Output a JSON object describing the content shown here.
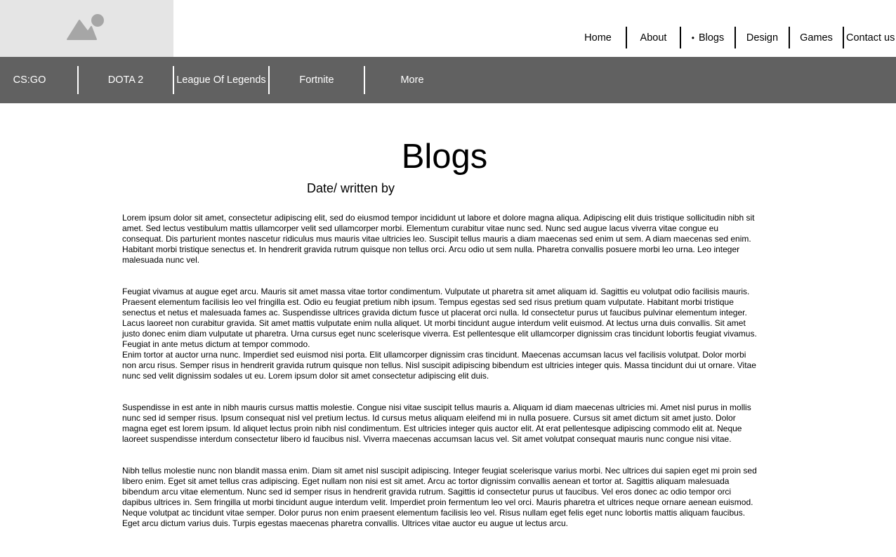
{
  "logo": {
    "icon": "image-placeholder-icon"
  },
  "nav": {
    "items": [
      {
        "label": "Home",
        "active": false
      },
      {
        "label": "About",
        "active": false
      },
      {
        "label": "Blogs",
        "active": true,
        "bullet": "•"
      },
      {
        "label": "Design",
        "active": false
      },
      {
        "label": "Games",
        "active": false
      },
      {
        "label": "Contact us",
        "active": false
      }
    ]
  },
  "games": {
    "items": [
      {
        "label": "CS:GO"
      },
      {
        "label": "DOTA 2"
      },
      {
        "label": "League Of Legends"
      },
      {
        "label": "Fortnite"
      },
      {
        "label": "More"
      }
    ]
  },
  "page": {
    "title": "Blogs",
    "byline": "Date/ written by"
  },
  "paragraphs": [
    "Lorem ipsum dolor sit amet, consectetur adipiscing elit, sed do eiusmod tempor incididunt ut labore et dolore magna aliqua. Adipiscing elit duis tristique sollicitudin nibh sit amet. Sed lectus vestibulum mattis ullamcorper velit sed ullamcorper morbi. Elementum curabitur vitae nunc sed. Nunc sed augue lacus viverra vitae congue eu consequat. Dis parturient montes nascetur ridiculus mus mauris vitae ultricies leo. Suscipit tellus mauris a diam maecenas sed enim ut sem. A diam maecenas sed enim. Habitant morbi tristique senectus et. In hendrerit gravida rutrum quisque non tellus orci. Arcu odio ut sem nulla. Pharetra convallis posuere morbi leo urna. Leo integer malesuada nunc vel.",
    "Feugiat vivamus at augue eget arcu. Mauris sit amet massa vitae tortor condimentum. Vulputate ut pharetra sit amet aliquam id. Sagittis eu volutpat odio facilisis mauris. Praesent elementum facilisis leo vel fringilla est. Odio eu feugiat pretium nibh ipsum. Tempus egestas sed sed risus pretium quam vulputate. Habitant morbi tristique senectus et netus et malesuada fames ac. Suspendisse ultrices gravida dictum fusce ut placerat orci nulla. Id consectetur purus ut faucibus pulvinar elementum integer. Lacus laoreet non curabitur gravida. Sit amet mattis vulputate enim nulla aliquet. Ut morbi tincidunt augue interdum velit euismod. At lectus urna duis convallis. Sit amet justo donec enim diam vulputate ut pharetra. Urna cursus eget nunc scelerisque viverra. Est pellentesque elit ullamcorper dignissim cras tincidunt lobortis feugiat vivamus. Feugiat in ante metus dictum at tempor commodo.",
    "Enim tortor at auctor urna nunc. Imperdiet sed euismod nisi porta. Elit ullamcorper dignissim cras tincidunt. Maecenas accumsan lacus vel facilisis volutpat. Dolor morbi non arcu risus. Semper risus in hendrerit gravida rutrum quisque non tellus. Nisl suscipit adipiscing bibendum est ultricies integer quis. Massa tincidunt dui ut ornare. Vitae nunc sed velit dignissim sodales ut eu. Lorem ipsum dolor sit amet consectetur adipiscing elit duis.",
    "Suspendisse in est ante in nibh mauris cursus mattis molestie. Congue nisi vitae suscipit tellus mauris a. Aliquam id diam maecenas ultricies mi. Amet nisl purus in mollis nunc sed id semper risus. Ipsum consequat nisl vel pretium lectus. Id cursus metus aliquam eleifend mi in nulla posuere. Cursus sit amet dictum sit amet justo. Dolor magna eget est lorem ipsum. Id aliquet lectus proin nibh nisl condimentum. Est ultricies integer quis auctor elit. At erat pellentesque adipiscing commodo elit at. Neque laoreet suspendisse interdum consectetur libero id faucibus nisl. Viverra maecenas accumsan lacus vel. Sit amet volutpat consequat mauris nunc congue nisi vitae.",
    "Nibh tellus molestie nunc non blandit massa enim. Diam sit amet nisl suscipit adipiscing. Integer feugiat scelerisque varius morbi. Nec ultrices dui sapien eget mi proin sed libero enim. Eget sit amet tellus cras adipiscing. Eget nullam non nisi est sit amet. Arcu ac tortor dignissim convallis aenean et tortor at. Sagittis aliquam malesuada bibendum arcu vitae elementum. Nunc sed id semper risus in hendrerit gravida rutrum. Sagittis id consectetur purus ut faucibus. Vel eros donec ac odio tempor orci dapibus ultrices in. Sem fringilla ut morbi tincidunt augue interdum velit. Imperdiet proin fermentum leo vel orci. Mauris pharetra et ultrices neque ornare aenean euismod. Neque volutpat ac tincidunt vitae semper. Dolor purus non enim praesent elementum facilisis leo vel. Risus nullam eget felis eget nunc lobortis mattis aliquam faucibus. Eget arcu dictum varius duis. Turpis egestas maecenas pharetra convallis. Ultrices vitae auctor eu augue ut lectus arcu."
  ],
  "colors": {
    "logo_bg": "#e5e5e5",
    "logo_icon": "#a6a6a6",
    "game_bar_bg": "#616161",
    "game_bar_text": "#ffffff"
  }
}
